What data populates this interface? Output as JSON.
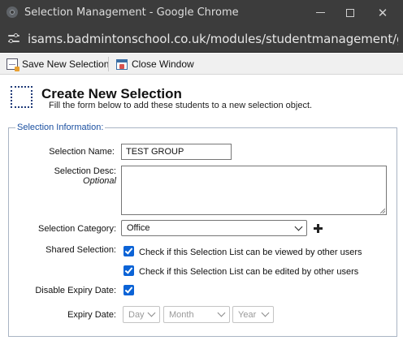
{
  "window": {
    "title": "Selection Management - Google Chrome",
    "url": "isams.badmintonschool.co.uk/modules/studentmanagement/groups/s..."
  },
  "toolbar": {
    "save_label": "Save New Selection",
    "close_label": "Close Window"
  },
  "header": {
    "title": "Create New Selection",
    "subtitle": "Fill the form below to add these students to a new selection object."
  },
  "form": {
    "legend": "Selection Information:",
    "name_label": "Selection Name:",
    "name_value": "TEST GROUP",
    "desc_label": "Selection Desc:",
    "desc_sublabel": "Optional",
    "desc_value": "",
    "category_label": "Selection Category:",
    "category_value": "Office",
    "shared_label": "Shared Selection:",
    "shared_view_text": "Check if this Selection List can be viewed by other users",
    "shared_view_checked": true,
    "shared_edit_text": "Check if this Selection List can be edited by other users",
    "shared_edit_checked": true,
    "disable_expiry_label": "Disable Expiry Date:",
    "disable_expiry_checked": true,
    "expiry_label": "Expiry Date:",
    "expiry_day": "Day",
    "expiry_month": "Month",
    "expiry_year": "Year"
  },
  "colors": {
    "checkbox": "#0b63d6",
    "legend": "#1a4fa0",
    "titlebar": "#3c3c3c"
  }
}
